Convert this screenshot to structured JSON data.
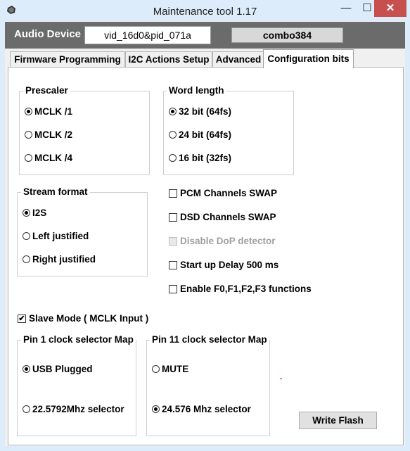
{
  "window": {
    "title": "Maintenance tool 1.17",
    "minimize": "—",
    "maximize": "☐",
    "close": "✕"
  },
  "header": {
    "device_label": "Audio Device",
    "vid_value": "vid_16d0&pid_071a",
    "combo_value": "combo384"
  },
  "tabs": [
    {
      "label": "Firmware Programming",
      "active": false
    },
    {
      "label": "I2C Actions Setup",
      "active": false
    },
    {
      "label": "Advanced",
      "active": false
    },
    {
      "label": "Configuration bits",
      "active": true
    }
  ],
  "prescaler": {
    "title": "Prescaler",
    "options": [
      "MCLK /1",
      "MCLK /2",
      "MCLK /4"
    ],
    "selected": 0
  },
  "word_length": {
    "title": "Word length",
    "options": [
      "32 bit (64fs)",
      "24 bit (64fs)",
      "16 bit (32fs)"
    ],
    "selected": 0
  },
  "stream_format": {
    "title": "Stream format",
    "options": [
      "I2S",
      "Left justified",
      "Right justified"
    ],
    "selected": 0
  },
  "checkboxes": [
    {
      "label": "PCM Channels SWAP",
      "checked": false,
      "enabled": true
    },
    {
      "label": "DSD Channels SWAP",
      "checked": false,
      "enabled": true
    },
    {
      "label": "Disable DoP detector",
      "checked": false,
      "enabled": false
    },
    {
      "label": "Start up Delay 500 ms",
      "checked": false,
      "enabled": true
    },
    {
      "label": "Enable F0,F1,F2,F3 functions",
      "checked": false,
      "enabled": true
    }
  ],
  "slave_mode": {
    "label": "Slave Mode ( MCLK Input )",
    "checked": true
  },
  "pin1": {
    "title": "Pin 1 clock selector Map",
    "options": [
      "USB Plugged",
      "22.5792Mhz selector"
    ],
    "selected": 0
  },
  "pin11": {
    "title": "Pin 11 clock selector Map",
    "options": [
      "MUTE",
      "24.576 Mhz selector"
    ],
    "selected": 1
  },
  "write_flash": "Write Flash",
  "colors": {
    "header_bar": "#6b6b6b",
    "title_bar": "#dcecfa",
    "close_button": "#c7504f"
  }
}
